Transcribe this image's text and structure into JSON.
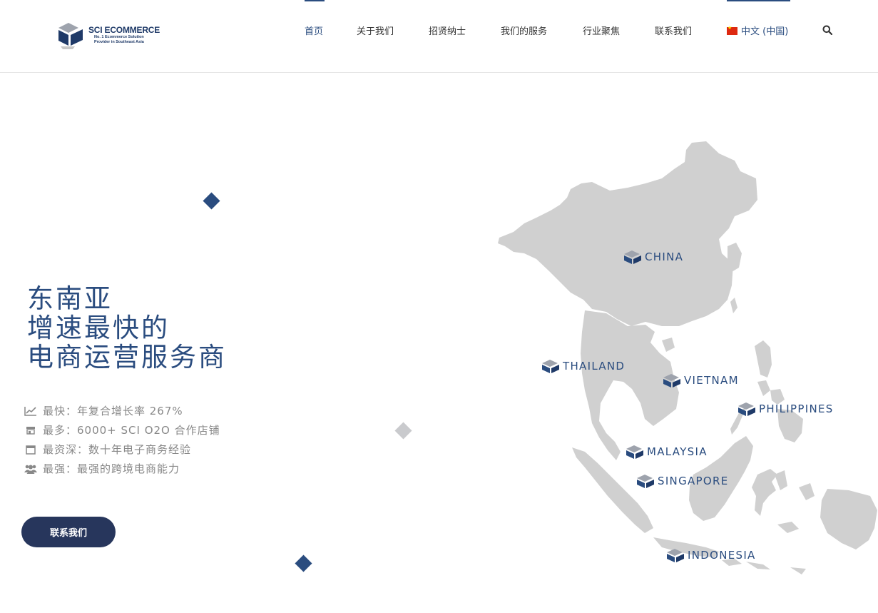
{
  "brand": {
    "name": "SCI ECOMMERCE",
    "tagline_1": "No. 1 Ecommerce Solution",
    "tagline_2": "Provider in Southeast Asia",
    "color": "#1f3a68"
  },
  "nav": {
    "items": [
      {
        "label": "首页",
        "active": true
      },
      {
        "label": "关于我们"
      },
      {
        "label": "招贤纳士"
      },
      {
        "label": "我们的服务"
      },
      {
        "label": "行业聚焦"
      },
      {
        "label": "联系我们"
      }
    ],
    "language": "中文 (中国)",
    "search_icon": "search-icon"
  },
  "hero": {
    "title_line_1": "东南亚",
    "title_line_2": "增速最快的",
    "title_line_3": "电商运营服务商",
    "features": [
      {
        "icon": "chart-icon",
        "text": "最快：年复合增长率 267%"
      },
      {
        "icon": "store-icon",
        "text": "最多：6000+ SCI O2O 合作店铺"
      },
      {
        "icon": "calendar-icon",
        "text": "最资深：数十年电子商务经验"
      },
      {
        "icon": "users-icon",
        "text": "最强：最强的跨境电商能力"
      }
    ],
    "cta_label": "联系我们"
  },
  "map": {
    "countries": [
      "CHINA",
      "THAILAND",
      "VIETNAM",
      "PHILIPPINES",
      "MALAYSIA",
      "SINGAPORE",
      "INDONESIA"
    ]
  },
  "colors": {
    "accent": "#2a4c7f",
    "button": "#27365c",
    "diamond_light": "#c9cacd",
    "map_land": "#d0d0d0"
  }
}
